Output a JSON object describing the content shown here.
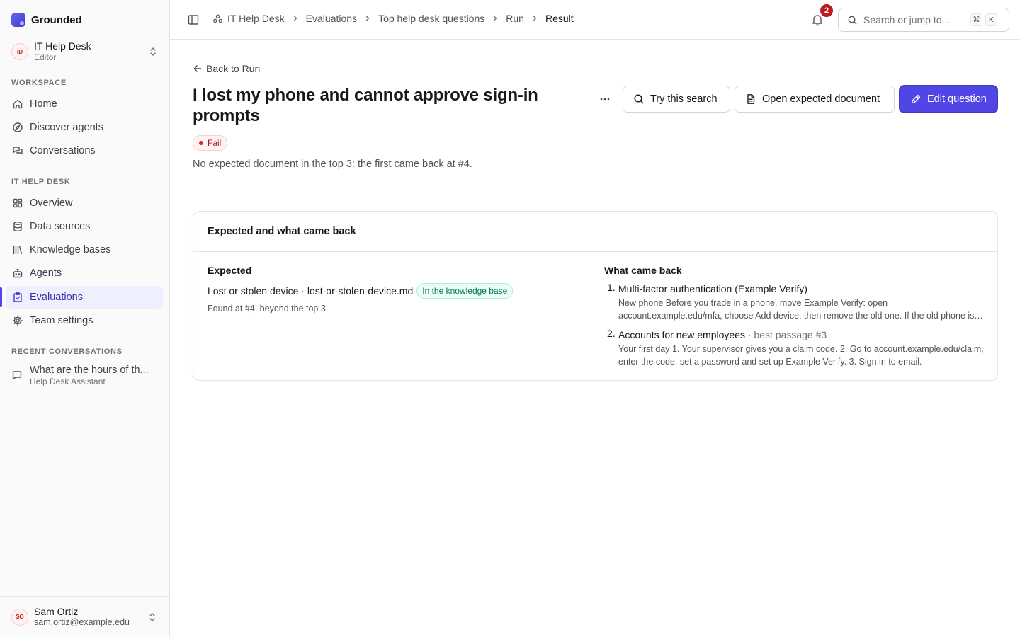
{
  "app": {
    "name": "Grounded"
  },
  "team": {
    "initials": "ID",
    "name": "IT Help Desk",
    "role": "Editor"
  },
  "sidebar": {
    "workspace_label": "WORKSPACE",
    "workspace_items": [
      {
        "label": "Home",
        "icon": "home-icon"
      },
      {
        "label": "Discover agents",
        "icon": "compass-icon"
      },
      {
        "label": "Conversations",
        "icon": "chat-bubbles-icon"
      }
    ],
    "team_label": "IT HELP DESK",
    "team_items": [
      {
        "label": "Overview",
        "icon": "dashboard-icon"
      },
      {
        "label": "Data sources",
        "icon": "database-icon"
      },
      {
        "label": "Knowledge bases",
        "icon": "library-icon"
      },
      {
        "label": "Agents",
        "icon": "bot-icon"
      },
      {
        "label": "Evaluations",
        "icon": "clipboard-check-icon",
        "active": true
      },
      {
        "label": "Team settings",
        "icon": "gear-icon"
      }
    ],
    "recent_label": "RECENT CONVERSATIONS",
    "recent": [
      {
        "title": "What are the hours of th...",
        "agent": "Help Desk Assistant"
      }
    ]
  },
  "user": {
    "initials": "SO",
    "name": "Sam Ortiz",
    "email": "sam.ortiz@example.edu"
  },
  "topbar": {
    "breadcrumbs": [
      "IT Help Desk",
      "Evaluations",
      "Top help desk questions",
      "Run",
      "Result"
    ],
    "notification_count": "2",
    "search_placeholder": "Search or jump to...",
    "shortcut_keys": [
      "⌘",
      "K"
    ]
  },
  "page": {
    "back_label": "Back to Run",
    "title": "I lost my phone and cannot approve sign-in prompts",
    "status": "Fail",
    "summary": "No expected document in the top 3: the first came back at #4.",
    "actions": {
      "try_search": "Try this search",
      "open_expected": "Open expected document",
      "edit_question": "Edit question"
    }
  },
  "comparison": {
    "card_title": "Expected and what came back",
    "expected_heading": "Expected",
    "expected_doc": "Lost or stolen device · lost-or-stolen-device.md",
    "expected_tag": "In the knowledge base",
    "expected_found": "Found at #4, beyond the top 3",
    "returned_heading": "What came back",
    "results": [
      {
        "rank": "1.",
        "title": "Multi-factor authentication (Example Verify)",
        "passage": "",
        "snippet": "New phone Before you trade in a phone, move Example Verify: open account.example.edu/mfa, choose Add device, then remove the old one. If the old phone is lost, contact the help desk."
      },
      {
        "rank": "2.",
        "title": "Accounts for new employees",
        "passage": " · best passage #3",
        "snippet": "Your first day 1. Your supervisor gives you a claim code. 2. Go to account.example.edu/claim, enter the code, set a password and set up Example Verify. 3. Sign in to email."
      }
    ]
  },
  "colors": {
    "accent": "#4f46e5",
    "fail": "#dc2626",
    "success": "#047857"
  }
}
